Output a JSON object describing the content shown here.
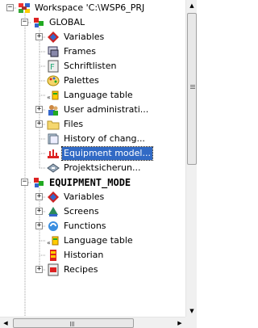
{
  "tree": {
    "nodes": [
      {
        "label": "Workspace 'C:\\WSP6_PRJ",
        "icon": "workspace-icon",
        "depth": 0,
        "expander": "-",
        "bold": false
      },
      {
        "label": "GLOBAL",
        "icon": "project-icon",
        "depth": 1,
        "expander": "-",
        "bold": false
      },
      {
        "label": "Variables",
        "icon": "variables-icon",
        "depth": 2,
        "expander": "+",
        "bold": false
      },
      {
        "label": "Frames",
        "icon": "frames-icon",
        "depth": 2,
        "expander": "",
        "bold": false
      },
      {
        "label": "Schriftlisten",
        "icon": "font-list-icon",
        "depth": 2,
        "expander": "",
        "bold": false
      },
      {
        "label": "Palettes",
        "icon": "palette-icon",
        "depth": 2,
        "expander": "",
        "bold": false
      },
      {
        "label": "Language table",
        "icon": "language-table-icon",
        "depth": 2,
        "expander": "",
        "bold": false
      },
      {
        "label": "User administrati...",
        "icon": "user-admin-icon",
        "depth": 2,
        "expander": "+",
        "bold": false
      },
      {
        "label": "Files",
        "icon": "folder-icon",
        "depth": 2,
        "expander": "+",
        "bold": false
      },
      {
        "label": "History of chang...",
        "icon": "history-icon",
        "depth": 2,
        "expander": "",
        "bold": false
      },
      {
        "label": "Equipment model...",
        "icon": "equipment-model-icon",
        "depth": 2,
        "expander": "",
        "bold": false,
        "selected": true
      },
      {
        "label": "Projektsicherun...",
        "icon": "project-backup-icon",
        "depth": 2,
        "expander": "",
        "bold": false
      },
      {
        "label": "EQUIPMENT_MODE",
        "icon": "project-icon",
        "depth": 1,
        "expander": "-",
        "bold": true
      },
      {
        "label": "Variables",
        "icon": "variables-icon",
        "depth": 2,
        "expander": "+",
        "bold": false
      },
      {
        "label": "Screens",
        "icon": "screens-icon",
        "depth": 2,
        "expander": "+",
        "bold": false
      },
      {
        "label": "Functions",
        "icon": "functions-icon",
        "depth": 2,
        "expander": "+",
        "bold": false
      },
      {
        "label": "Language table",
        "icon": "language-table-icon",
        "depth": 2,
        "expander": "",
        "bold": false
      },
      {
        "label": "Historian",
        "icon": "historian-icon",
        "depth": 2,
        "expander": "",
        "bold": false
      },
      {
        "label": "Recipes",
        "icon": "recipes-icon",
        "depth": 2,
        "expander": "+",
        "bold": false
      }
    ]
  },
  "scrollbars": {
    "vertical": {
      "up_arrow": "▲",
      "down_arrow": "▼"
    },
    "horizontal": {
      "left_arrow": "◀",
      "right_arrow": "▶"
    }
  },
  "colors": {
    "selection": "#316ac5",
    "tree_lines": "#a0a0a0"
  }
}
